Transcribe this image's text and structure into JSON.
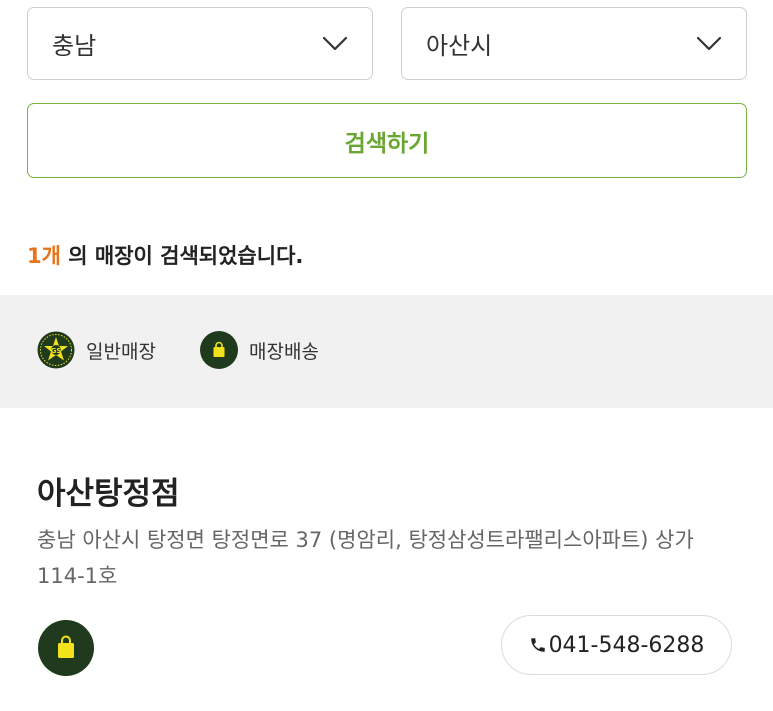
{
  "filters": {
    "region": {
      "value": "충남",
      "icon": "chevron-down-icon"
    },
    "city": {
      "value": "아산시",
      "icon": "chevron-down-icon"
    }
  },
  "search": {
    "label": "검색하기",
    "color": "#6aa632"
  },
  "result": {
    "count": "1개",
    "suffix": " 의 매장이 검색되었습니다.",
    "count_color": "#e8731a"
  },
  "legend": [
    {
      "label": "일반매장",
      "icon": "general-store-emblem-icon"
    },
    {
      "label": "매장배송",
      "icon": "shopping-bag-icon"
    }
  ],
  "stores": [
    {
      "name": "아산탕정점",
      "address": "충남 아산시 탕정면 탕정면로 37 (명암리, 탕정삼성트라팰리스아파트) 상가 114-1호",
      "type_icon": "shopping-bag-icon",
      "phone": "041-548-6288"
    }
  ],
  "colors": {
    "brand_dark": "#1f3a1c",
    "bag_yellow": "#f2e21c",
    "accent_green": "#7bb241"
  }
}
